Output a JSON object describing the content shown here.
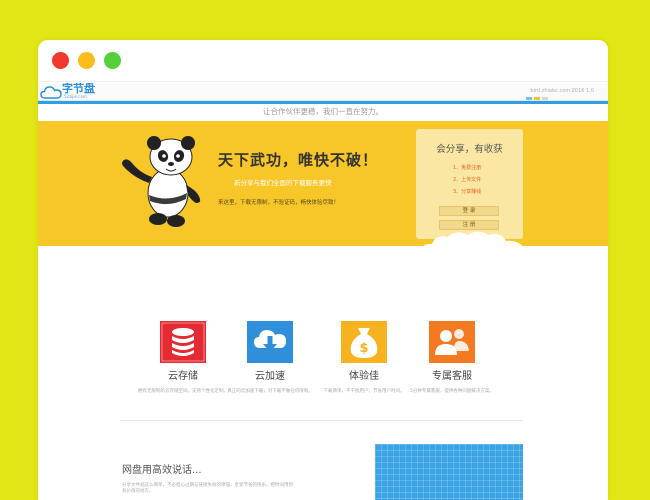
{
  "site": {
    "logo_text": "字节盘",
    "logo_sub": "52zijie.com",
    "header_right": "bird.zhiabc.com 2016 1.0",
    "tagline": "让合作伙伴更稳，我们一直在努力。"
  },
  "hero": {
    "title": "天下武功，唯快不破！",
    "subtitle": "新分享与我们全面的下载服务更快",
    "description": "来这里，下载无限制，不验证码，畅快体验尽致！"
  },
  "login_card": {
    "title": "会分享，有收获",
    "items": [
      "1、免费注册",
      "2、上传文件",
      "3、分享赚钱"
    ],
    "login_button": "登 录",
    "register_button": "注 册"
  },
  "features": [
    {
      "label": "云存储",
      "desc": "拥有无限制的云存储空间，支持个性化定制。",
      "icon": "database-icon",
      "color": "#e42b34"
    },
    {
      "label": "云加速",
      "desc": "真正的云加速下载，对下载不做任何限制。",
      "icon": "cloud-download-icon",
      "color": "#2f8fdb"
    },
    {
      "label": "体验佳",
      "desc": "下载简单，不干扰用户，节省用户时间。",
      "icon": "money-bag-icon",
      "color": "#f7b21f"
    },
    {
      "label": "专属客服",
      "desc": "5分钟专属客服，提供各种问题解决方案。",
      "icon": "customer-service-icon",
      "color": "#f47a22"
    }
  ],
  "bottom": {
    "title": "网盘用高效说话...",
    "description": "分享文件就这么简单，不必担心过期与链接失效的烦恼，享受节省的快乐，把时间用到有价值的地方。"
  },
  "colors": {
    "background": "#e2e614",
    "hero": "#f7c628",
    "card": "#fbe7a4",
    "accent_blue": "#2c9fe5"
  }
}
